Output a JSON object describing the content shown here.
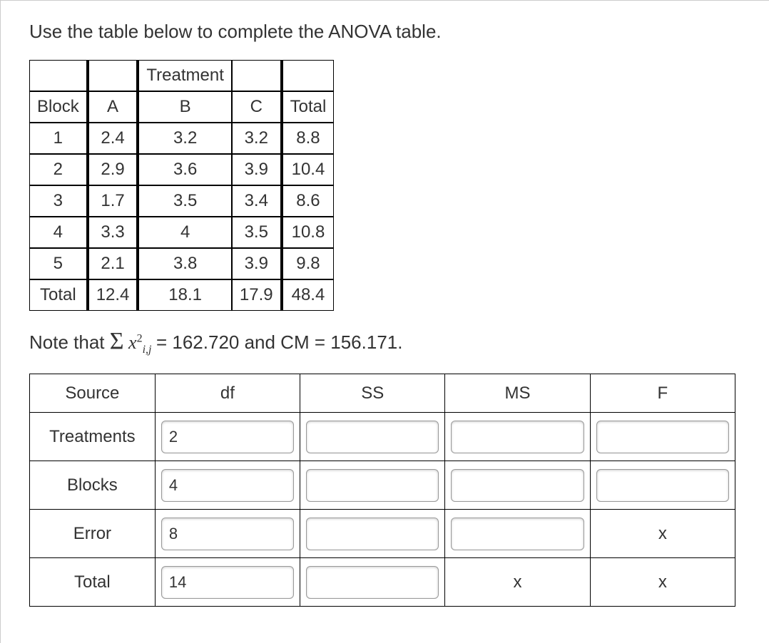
{
  "prompt": "Use the table below to complete the ANOVA table.",
  "data_table": {
    "header_spanning": "Treatment",
    "header": {
      "block": "Block",
      "a": "A",
      "b": "B",
      "c": "C",
      "total": "Total"
    },
    "rows": [
      {
        "block": "1",
        "a": "2.4",
        "b": "3.2",
        "c": "3.2",
        "total": "8.8"
      },
      {
        "block": "2",
        "a": "2.9",
        "b": "3.6",
        "c": "3.9",
        "total": "10.4"
      },
      {
        "block": "3",
        "a": "1.7",
        "b": "3.5",
        "c": "3.4",
        "total": "8.6"
      },
      {
        "block": "4",
        "a": "3.3",
        "b": "4",
        "c": "3.5",
        "total": "10.8"
      },
      {
        "block": "5",
        "a": "2.1",
        "b": "3.8",
        "c": "3.9",
        "total": "9.8"
      }
    ],
    "footer": {
      "label": "Total",
      "a": "12.4",
      "b": "18.1",
      "c": "17.9",
      "total": "48.4"
    }
  },
  "note": {
    "prefix": "Note that ",
    "sigma": "Σ",
    "var": "x",
    "sup": "2",
    "sub": "i,j",
    "eq": " = 162.720 and CM = 156.171."
  },
  "anova": {
    "headers": {
      "source": "Source",
      "df": "df",
      "ss": "SS",
      "ms": "MS",
      "f": "F"
    },
    "rows": {
      "treatments": {
        "label": "Treatments",
        "df": "2",
        "ss": "",
        "ms": "",
        "f": ""
      },
      "blocks": {
        "label": "Blocks",
        "df": "4",
        "ss": "",
        "ms": "",
        "f": ""
      },
      "error": {
        "label": "Error",
        "df": "8",
        "ss": "",
        "ms": "",
        "f_x": "x"
      },
      "total": {
        "label": "Total",
        "df": "14",
        "ss": "",
        "ms_x": "x",
        "f_x": "x"
      }
    }
  },
  "chart_data": {
    "type": "table",
    "title": "Randomized Block Design data and ANOVA skeleton",
    "dataset": {
      "blocks": [
        1,
        2,
        3,
        4,
        5
      ],
      "treatments": [
        "A",
        "B",
        "C"
      ],
      "values": {
        "A": [
          2.4,
          2.9,
          1.7,
          3.3,
          2.1
        ],
        "B": [
          3.2,
          3.6,
          3.5,
          4.0,
          3.8
        ],
        "C": [
          3.2,
          3.9,
          3.4,
          3.5,
          3.9
        ]
      },
      "row_totals": [
        8.8,
        10.4,
        8.6,
        10.8,
        9.8
      ],
      "col_totals": [
        12.4,
        18.1,
        17.9
      ],
      "grand_total": 48.4
    },
    "given": {
      "sum_x_sq": 162.72,
      "cm": 156.171
    },
    "anova_skeleton": {
      "sources": [
        "Treatments",
        "Blocks",
        "Error",
        "Total"
      ],
      "df": [
        2,
        4,
        8,
        14
      ]
    }
  }
}
